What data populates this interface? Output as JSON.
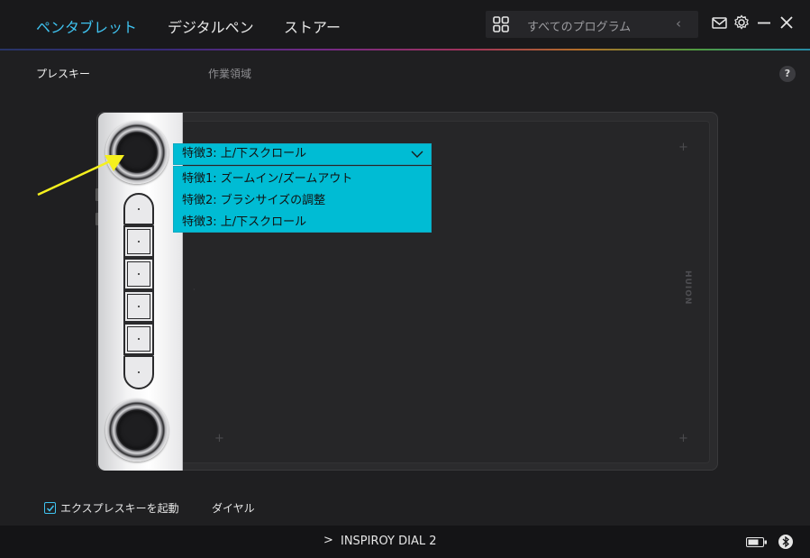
{
  "header": {
    "tabs": [
      {
        "label": "ペンタブレット",
        "active": true
      },
      {
        "label": "デジタルペン",
        "active": false
      },
      {
        "label": "ストアー",
        "active": false
      }
    ],
    "program_selector": {
      "label": "すべてのプログラム",
      "icon": "grid-icon"
    },
    "icons": [
      "mail-icon",
      "gear-icon",
      "minimize-icon",
      "close-icon"
    ]
  },
  "subtabs": {
    "press_keys": "プレスキー",
    "work_area": "作業領域",
    "help": "?"
  },
  "tablet": {
    "brand": "HUION",
    "dropdown": {
      "selected": "特徴3: 上/下スクロール",
      "options": [
        "特徴1: ズームイン/ズームアウト",
        "特徴2: ブラシサイズの調整",
        "特徴3: 上/下スクロール"
      ]
    }
  },
  "footer": {
    "express_keys_checkbox": {
      "label": "エクスプレスキーを起動",
      "checked": true
    },
    "dial_link": "ダイヤル"
  },
  "statusbar": {
    "device_name": "INSPIROY DIAL 2",
    "chevron": ">"
  },
  "colors": {
    "accent": "#3fc2ef",
    "dropdown_bg": "#00bcd4",
    "arrow": "#f5f01e",
    "background": "#1f1f21"
  }
}
